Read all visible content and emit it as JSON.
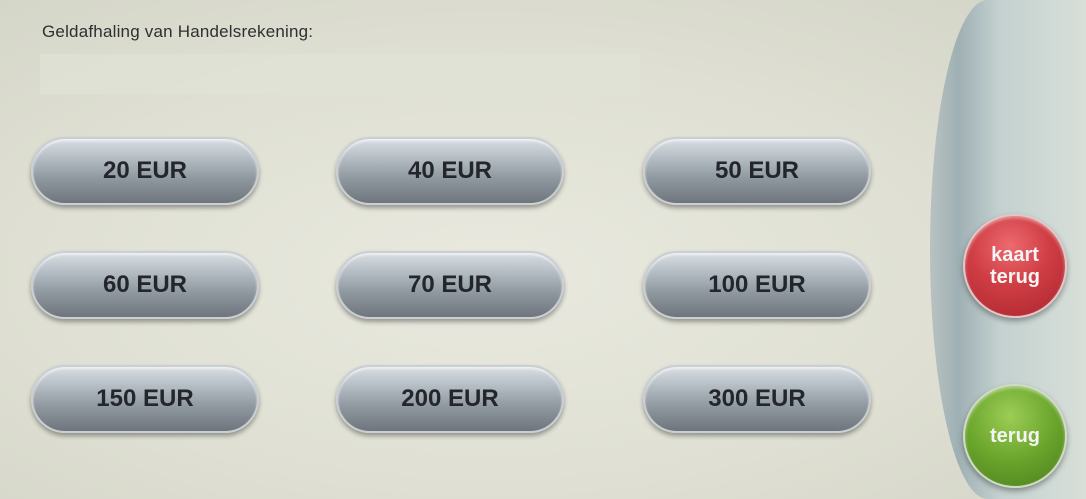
{
  "header": {
    "title": "Geldafhaling van Handelsrekening:"
  },
  "amounts": [
    "20 EUR",
    "40 EUR",
    "50 EUR",
    "60 EUR",
    "70 EUR",
    "100 EUR",
    "150 EUR",
    "200 EUR",
    "300 EUR"
  ],
  "side": {
    "card_return_line1": "kaart",
    "card_return_line2": "terug",
    "back_label": "terug"
  },
  "colors": {
    "background": "#e3e4d8",
    "amount_button": "#9aa1a8",
    "card_return_button": "#cf3d44",
    "back_button": "#6aa52c"
  }
}
